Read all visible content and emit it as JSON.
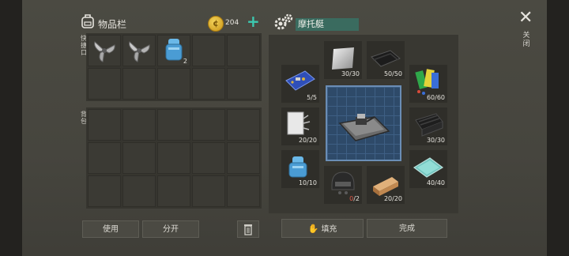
{
  "header": {
    "inventory_title": "物品栏",
    "coins": "204",
    "add_coins": "+",
    "craft_target": "摩托艇",
    "close_symbol": "✕",
    "close_label": "关闭"
  },
  "inventory": {
    "quick_label": "快捷口",
    "backpack_label": "背包",
    "quick_slots": [
      {
        "item": "propeller-icon",
        "count": ""
      },
      {
        "item": "propeller-icon",
        "count": ""
      },
      {
        "item": "fuel-tank-icon",
        "count": "2"
      },
      {
        "item": "",
        "count": ""
      },
      {
        "item": "",
        "count": ""
      },
      {
        "item": "",
        "count": ""
      },
      {
        "item": "",
        "count": ""
      },
      {
        "item": "",
        "count": ""
      },
      {
        "item": "",
        "count": ""
      },
      {
        "item": "",
        "count": ""
      }
    ],
    "backpack_slot_count": 15
  },
  "crafting": {
    "ingredients": {
      "metal_sheet": "30/30",
      "rubber": "50/50",
      "circuit_board": "5/5",
      "paint": "60/60",
      "fabric": "20/20",
      "steel_plate": "30/30",
      "fuel_tank": "10/10",
      "helmet_have": "0",
      "helmet_need": "/2",
      "wood_plank": "20/20",
      "glass": "40/40"
    }
  },
  "buttons": {
    "use": "使用",
    "split": "分开",
    "fill": "填充",
    "done": "完成"
  },
  "colors": {
    "accent": "#3cc9b0",
    "craft_name_bg": "#3a6b5f",
    "missing": "#e05a4a"
  }
}
